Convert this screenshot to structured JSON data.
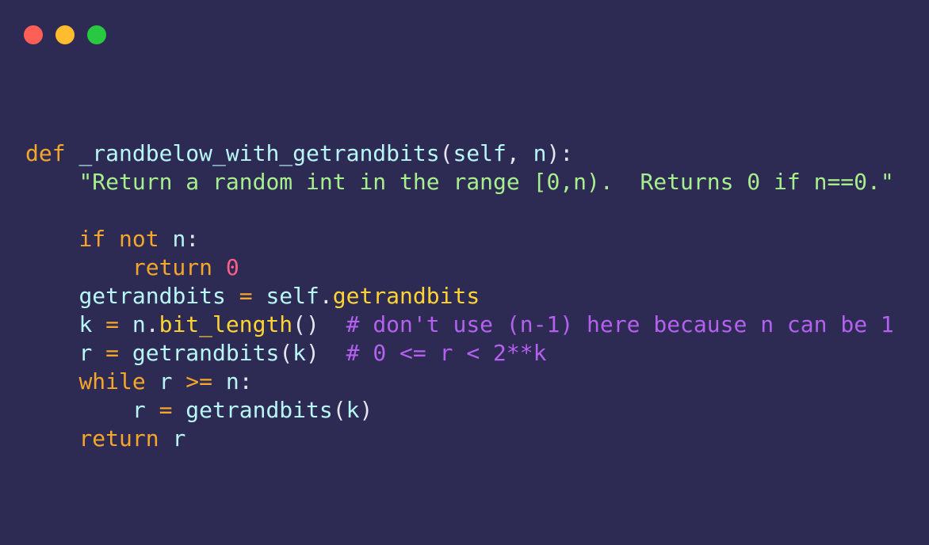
{
  "window": {
    "controls": [
      {
        "name": "close-dot",
        "color": "#ff5f57"
      },
      {
        "name": "minimize-dot",
        "color": "#febc2e"
      },
      {
        "name": "maximize-dot",
        "color": "#28c840"
      }
    ]
  },
  "colors": {
    "background": "#2d2a53",
    "keyword": "#f6a62b",
    "identifier": "#b8f6f7",
    "function": "#fed434",
    "string": "#a7ef8d",
    "number": "#ff5f8c",
    "comment": "#b561f0",
    "punctuation": "#e6e6f0"
  },
  "code": {
    "language": "python",
    "lines": [
      [
        [
          "kw",
          "def "
        ],
        [
          "id",
          "_randbelow_with_getrandbits"
        ],
        [
          "pn",
          "("
        ],
        [
          "id",
          "self"
        ],
        [
          "pn",
          ", "
        ],
        [
          "id",
          "n"
        ],
        [
          "pn",
          "):"
        ]
      ],
      [
        [
          "ws",
          "    "
        ],
        [
          "str",
          "\"Return a random int in the range [0,n).  Returns 0 if n==0.\""
        ]
      ],
      [],
      [
        [
          "ws",
          "    "
        ],
        [
          "kw",
          "if not "
        ],
        [
          "id",
          "n"
        ],
        [
          "pn",
          ":"
        ]
      ],
      [
        [
          "ws",
          "        "
        ],
        [
          "kw",
          "return "
        ],
        [
          "num",
          "0"
        ]
      ],
      [
        [
          "ws",
          "    "
        ],
        [
          "id",
          "getrandbits"
        ],
        [
          "kw",
          " = "
        ],
        [
          "id",
          "self"
        ],
        [
          "pn",
          "."
        ],
        [
          "fn",
          "getrandbits"
        ]
      ],
      [
        [
          "ws",
          "    "
        ],
        [
          "id",
          "k"
        ],
        [
          "kw",
          " = "
        ],
        [
          "id",
          "n"
        ],
        [
          "pn",
          "."
        ],
        [
          "fn",
          "bit_length"
        ],
        [
          "pn",
          "()  "
        ],
        [
          "cm",
          "# don't use (n-1) here because n can be 1"
        ]
      ],
      [
        [
          "ws",
          "    "
        ],
        [
          "id",
          "r"
        ],
        [
          "kw",
          " = "
        ],
        [
          "id",
          "getrandbits"
        ],
        [
          "pn",
          "("
        ],
        [
          "id",
          "k"
        ],
        [
          "pn",
          ")  "
        ],
        [
          "cm",
          "# 0 <= r < 2**k"
        ]
      ],
      [
        [
          "ws",
          "    "
        ],
        [
          "kw",
          "while "
        ],
        [
          "id",
          "r"
        ],
        [
          "kw",
          " >= "
        ],
        [
          "id",
          "n"
        ],
        [
          "pn",
          ":"
        ]
      ],
      [
        [
          "ws",
          "        "
        ],
        [
          "id",
          "r"
        ],
        [
          "kw",
          " = "
        ],
        [
          "id",
          "getrandbits"
        ],
        [
          "pn",
          "("
        ],
        [
          "id",
          "k"
        ],
        [
          "pn",
          ")"
        ]
      ],
      [
        [
          "ws",
          "    "
        ],
        [
          "kw",
          "return "
        ],
        [
          "id",
          "r"
        ]
      ]
    ]
  }
}
